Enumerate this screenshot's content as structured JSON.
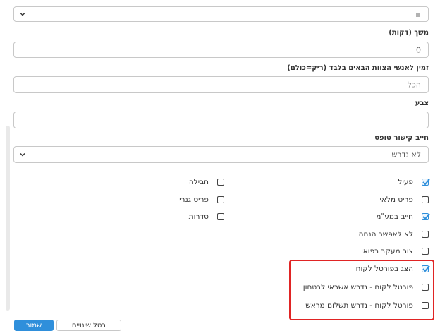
{
  "top_select": {
    "value": "",
    "icon": "sort-icon"
  },
  "duration": {
    "label": "משך (דקות)",
    "value": "0"
  },
  "next_available": {
    "label": "זמין לאנשי הצוות הבאים בלבד (ריק=כולם)",
    "placeholder": "הכל"
  },
  "color": {
    "label": "צבע",
    "value": ""
  },
  "form_link": {
    "label": "חייב קישור טופס",
    "value": "לא נדרש"
  },
  "checkboxes_right": [
    {
      "label": "פעיל",
      "checked": true
    },
    {
      "label": "פריט מלאי",
      "checked": false
    },
    {
      "label": "חייב במע\"מ",
      "checked": true
    },
    {
      "label": "לא לאפשר הנחה",
      "checked": false
    },
    {
      "label": "צור מעקב רפואי",
      "checked": false
    },
    {
      "label": "הצג בפורטל לקוח",
      "checked": true
    },
    {
      "label": "פורטל לקוח - נדרש אשראי לבטחון",
      "checked": false
    },
    {
      "label": "פורטל לקוח - נדרש תשלום מראש",
      "checked": false
    }
  ],
  "checkboxes_left": [
    {
      "label": "חבילה",
      "checked": false
    },
    {
      "label": "פריט גנרי",
      "checked": false
    },
    {
      "label": "סדרות",
      "checked": false
    }
  ],
  "buttons": {
    "save": "שמור",
    "cancel": "בטל שינויים"
  },
  "colors": {
    "accent": "#2f8fdb",
    "highlight": "#e02424"
  }
}
